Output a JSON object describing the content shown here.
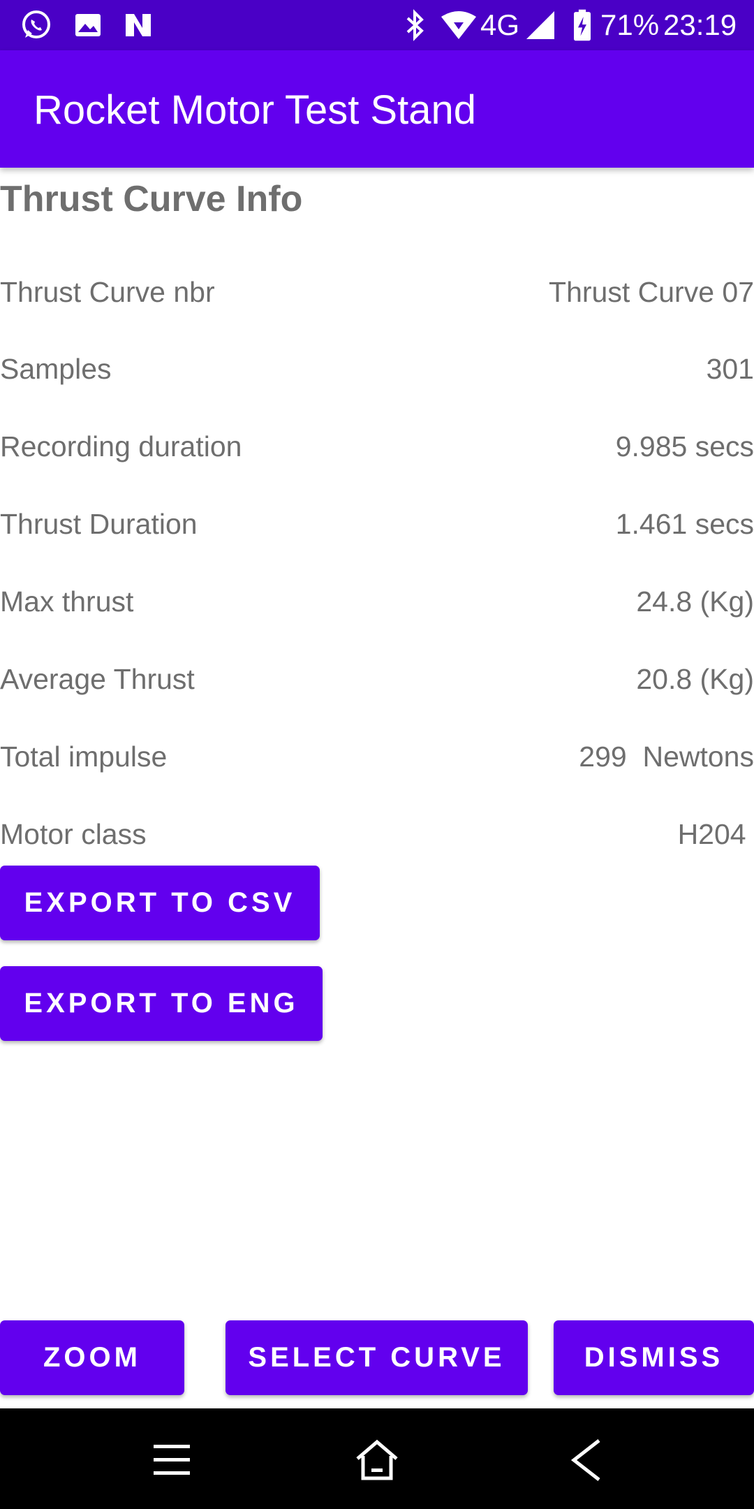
{
  "status_bar": {
    "network": "4G",
    "battery": "71%",
    "time": "23:19",
    "icons_left": [
      "whatsapp-icon",
      "image-icon",
      "n-app-icon"
    ],
    "icons_right": [
      "bluetooth-icon",
      "wifi-icon",
      "signal-icon",
      "battery-icon"
    ]
  },
  "app_bar": {
    "title": "Rocket Motor Test Stand"
  },
  "info": {
    "title": "Thrust Curve Info",
    "rows": [
      {
        "label": "Thrust Curve nbr",
        "value": "Thrust Curve 07"
      },
      {
        "label": "Samples",
        "value": "301"
      },
      {
        "label": "Recording duration",
        "value": "9.985 secs"
      },
      {
        "label": "Thrust Duration",
        "value": "1.461 secs"
      },
      {
        "label": "Max thrust",
        "value": "24.8 (Kg)"
      },
      {
        "label": "Average Thrust",
        "value": "20.8 (Kg)"
      },
      {
        "label": "Total impulse",
        "value": "299  Newtons"
      },
      {
        "label": "Motor class",
        "value": "H204 "
      }
    ]
  },
  "buttons": {
    "export_csv": "EXPORT TO CSV",
    "export_eng": "EXPORT TO ENG",
    "zoom": "ZOOM",
    "select_curve": "SELECT CURVE",
    "dismiss": "DISMISS"
  },
  "nav_bar": {
    "icons": [
      "menu-icon",
      "home-icon",
      "back-icon"
    ]
  },
  "colors": {
    "primary": "#6200ee",
    "status_bar": "#4a00c6",
    "text_gray": "#6e6e6e"
  }
}
